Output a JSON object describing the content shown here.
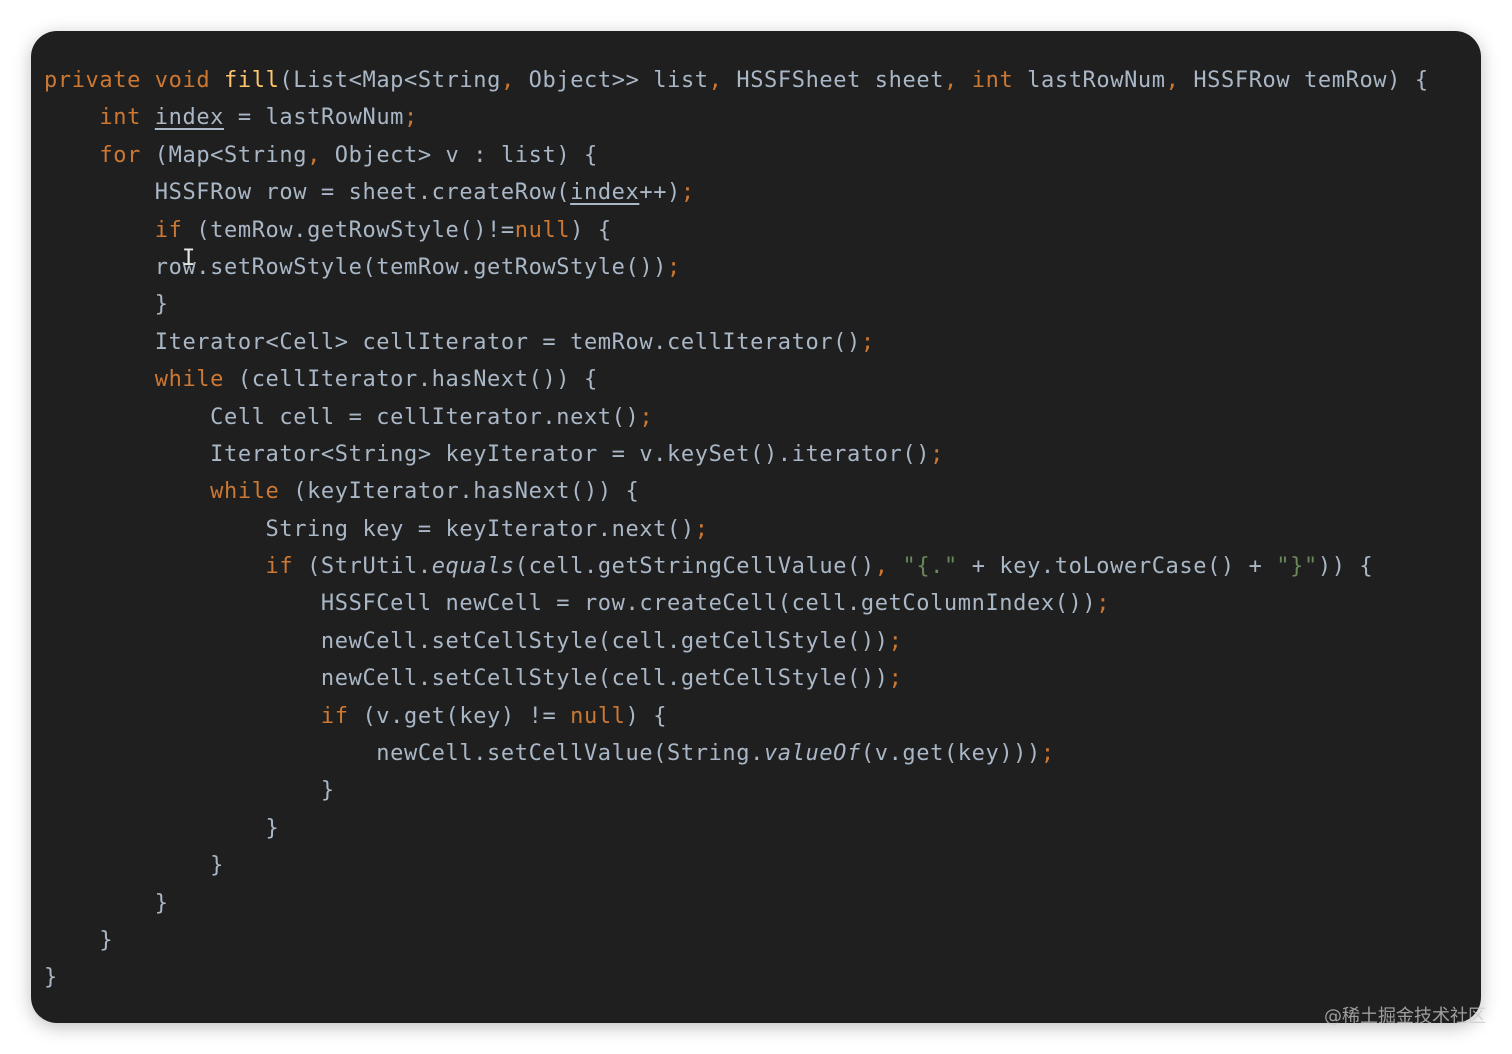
{
  "colors": {
    "background": "#1f1f1f",
    "keyword": "#cc7832",
    "function_name": "#ffc66d",
    "default_text": "#a9b7c6",
    "string": "#6a8759"
  },
  "code": {
    "lines": [
      [
        {
          "t": "private",
          "c": "kw"
        },
        {
          "t": " "
        },
        {
          "t": "void",
          "c": "kw"
        },
        {
          "t": " "
        },
        {
          "t": "fill",
          "c": "fn"
        },
        {
          "t": "(List<Map<String"
        },
        {
          "t": ",",
          "c": "pu"
        },
        {
          "t": " Object>> list"
        },
        {
          "t": ",",
          "c": "pu"
        },
        {
          "t": " HSSFSheet sheet"
        },
        {
          "t": ",",
          "c": "pu"
        },
        {
          "t": " "
        },
        {
          "t": "int",
          "c": "kw"
        },
        {
          "t": " lastRowNum"
        },
        {
          "t": ",",
          "c": "pu"
        },
        {
          "t": " HSSFRow temRow) {"
        }
      ],
      [
        {
          "t": "    "
        },
        {
          "t": "int",
          "c": "kw"
        },
        {
          "t": " "
        },
        {
          "t": "index",
          "c": "ul"
        },
        {
          "t": " = lastRowNum"
        },
        {
          "t": ";",
          "c": "pu"
        }
      ],
      [
        {
          "t": "    "
        },
        {
          "t": "for",
          "c": "kw"
        },
        {
          "t": " (Map<String"
        },
        {
          "t": ",",
          "c": "pu"
        },
        {
          "t": " Object> v : list) {"
        }
      ],
      [
        {
          "t": "        HSSFRow row = sheet.createRow("
        },
        {
          "t": "index",
          "c": "ul"
        },
        {
          "t": "++)"
        },
        {
          "t": ";",
          "c": "pu"
        }
      ],
      [
        {
          "t": "        "
        },
        {
          "t": "if",
          "c": "kw"
        },
        {
          "t": " (temRow.getRowStyle()!="
        },
        {
          "t": "null",
          "c": "kw"
        },
        {
          "t": ") {"
        }
      ],
      [
        {
          "t": "        row.setRowStyle(temRow.getRowStyle())"
        },
        {
          "t": ";",
          "c": "pu"
        }
      ],
      [
        {
          "t": "        }"
        }
      ],
      [
        {
          "t": "        Iterator<Cell> cellIterator = temRow.cellIterator()"
        },
        {
          "t": ";",
          "c": "pu"
        }
      ],
      [
        {
          "t": "        "
        },
        {
          "t": "while",
          "c": "kw"
        },
        {
          "t": " (cellIterator.hasNext()) {"
        }
      ],
      [
        {
          "t": "            Cell cell = cellIterator.next()"
        },
        {
          "t": ";",
          "c": "pu"
        }
      ],
      [
        {
          "t": "            Iterator<String> keyIterator = v.keySet().iterator()"
        },
        {
          "t": ";",
          "c": "pu"
        }
      ],
      [
        {
          "t": "            "
        },
        {
          "t": "while",
          "c": "kw"
        },
        {
          "t": " (keyIterator.hasNext()) {"
        }
      ],
      [
        {
          "t": "                String key = keyIterator.next()"
        },
        {
          "t": ";",
          "c": "pu"
        }
      ],
      [
        {
          "t": "                "
        },
        {
          "t": "if",
          "c": "kw"
        },
        {
          "t": " (StrUtil."
        },
        {
          "t": "equals",
          "c": "it"
        },
        {
          "t": "(cell.getStringCellValue()"
        },
        {
          "t": ",",
          "c": "pu"
        },
        {
          "t": " "
        },
        {
          "t": "\"{.\"",
          "c": "st"
        },
        {
          "t": " + key.toLowerCase() + "
        },
        {
          "t": "\"}\"",
          "c": "st"
        },
        {
          "t": ")) {"
        }
      ],
      [
        {
          "t": "                    HSSFCell newCell = row.createCell(cell.getColumnIndex())"
        },
        {
          "t": ";",
          "c": "pu"
        }
      ],
      [
        {
          "t": "                    newCell.setCellStyle(cell.getCellStyle())"
        },
        {
          "t": ";",
          "c": "pu"
        }
      ],
      [
        {
          "t": "                    newCell.setCellStyle(cell.getCellStyle())"
        },
        {
          "t": ";",
          "c": "pu"
        }
      ],
      [
        {
          "t": "                    "
        },
        {
          "t": "if",
          "c": "kw"
        },
        {
          "t": " (v.get(key) != "
        },
        {
          "t": "null",
          "c": "kw"
        },
        {
          "t": ") {"
        }
      ],
      [
        {
          "t": "                        newCell.setCellValue(String."
        },
        {
          "t": "valueOf",
          "c": "it"
        },
        {
          "t": "(v.get(key)))"
        },
        {
          "t": ";",
          "c": "pu"
        }
      ],
      [
        {
          "t": "                    }"
        }
      ],
      [
        {
          "t": "                }"
        }
      ],
      [
        {
          "t": "            }"
        }
      ],
      [
        {
          "t": "        }"
        }
      ],
      [
        {
          "t": "    }"
        }
      ],
      [
        {
          "t": "}"
        }
      ]
    ]
  },
  "caret_glyph": "I",
  "watermark": "@稀土掘金技术社区"
}
